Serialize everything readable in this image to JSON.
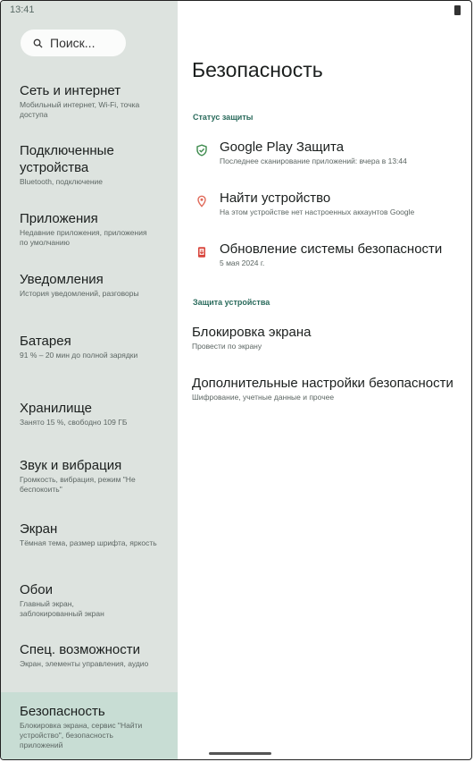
{
  "status_bar": {
    "time": "13:41"
  },
  "search": {
    "placeholder": "Поиск..."
  },
  "sidebar": {
    "items": [
      {
        "label": "Сеть и интернет",
        "sub": "Мобильный интернет, Wi-Fi, точка доступа"
      },
      {
        "label": "Подключенные устройства",
        "sub": "Bluetooth, подключение"
      },
      {
        "label": "Приложения",
        "sub": "Недавние приложения, приложения по умолчанию"
      },
      {
        "label": "Уведомления",
        "sub": "История уведомлений, разговоры"
      },
      {
        "label": "Батарея",
        "sub": "91 % – 20 мин до полной зарядки"
      },
      {
        "label": "Хранилище",
        "sub": "Занято 15 %, свободно 109 ГБ"
      },
      {
        "label": "Звук и вибрация",
        "sub": "Громкость, вибрация, режим \"Не беспокоить\""
      },
      {
        "label": "Экран",
        "sub": "Тёмная тема, размер шрифта, яркость"
      },
      {
        "label": "Обои",
        "sub": "Главный экран, заблокированный экран"
      },
      {
        "label": "Спец. возможности",
        "sub": "Экран, элементы управления, аудио"
      },
      {
        "label": "Безопасность",
        "sub": "Блокировка экрана, сервис \"Найти устройство\", безопасность приложений"
      }
    ]
  },
  "main": {
    "title": "Безопасность",
    "status_section": {
      "header": "Статус защиты",
      "rows": [
        {
          "title": "Google Play Защита",
          "sub": "Последнее сканирование приложений: вчера в 13:44",
          "icon": "shield-check-icon",
          "color": "#3c8a4c"
        },
        {
          "title": "Найти устройство",
          "sub": "На этом устройстве нет настроенных аккаунтов Google",
          "icon": "location-pin-icon",
          "color": "#e06a5a"
        },
        {
          "title": "Обновление системы безопасности",
          "sub": "5 мая 2024 г.",
          "icon": "security-update-icon",
          "color": "#d8453c"
        }
      ]
    },
    "device_section": {
      "header": "Защита устройства",
      "rows": [
        {
          "title": "Блокировка экрана",
          "sub": "Провести по экрану"
        },
        {
          "title": "Дополнительные настройки безопасности",
          "sub": "Шифрование, учетные данные и прочее"
        }
      ]
    }
  }
}
